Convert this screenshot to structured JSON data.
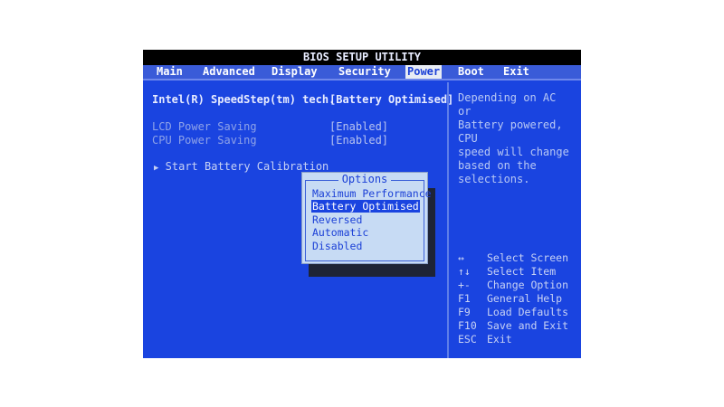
{
  "title": "BIOS SETUP UTILITY",
  "menu": [
    "Main",
    "Advanced",
    "Display",
    "Security",
    "Power",
    "Boot",
    "Exit"
  ],
  "active_tab": "Power",
  "settings": [
    {
      "label": "Intel(R) SpeedStep(tm) tech.",
      "value": "[Battery Optimised]"
    },
    {
      "label": "LCD Power Saving",
      "value": "[Enabled]"
    },
    {
      "label": "CPU Power Saving",
      "value": "[Enabled]"
    }
  ],
  "submenu": {
    "marker": "▶",
    "label": "Start Battery Calibration"
  },
  "help": {
    "lines": [
      "Depending on AC or",
      "Battery powered, CPU",
      "speed will change",
      "based on the",
      "selections."
    ]
  },
  "keys": [
    {
      "key": "↔",
      "action": "Select Screen"
    },
    {
      "key": "↑↓",
      "action": "Select Item"
    },
    {
      "key": "+-",
      "action": "Change Option"
    },
    {
      "key": "F1",
      "action": "General Help"
    },
    {
      "key": "F9",
      "action": "Load Defaults"
    },
    {
      "key": "F10",
      "action": "Save and Exit"
    },
    {
      "key": "ESC",
      "action": "Exit"
    }
  ],
  "popup": {
    "title": "Options",
    "options": [
      "Maximum Performance",
      "Battery Optimised",
      "Reversed",
      "Automatic",
      "Disabled"
    ],
    "selected": "Battery Optimised"
  }
}
